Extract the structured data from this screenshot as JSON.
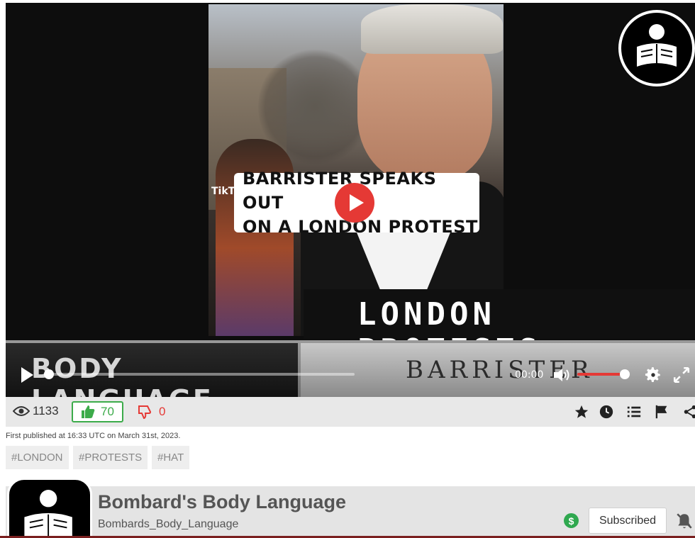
{
  "video": {
    "caption_line1": "BARRISTER SPEAKS OUT",
    "caption_line2": "ON A LONDON PROTEST",
    "tiktok_label": "TikTok",
    "banner_text": "LONDON PROTESTS",
    "lower_left_text": "BODY LANGUAGE",
    "lower_right_text": "BARRISTER",
    "time": "00:00",
    "progress": 0.0,
    "volume": 0.85
  },
  "stats": {
    "views": "1133",
    "likes": "70",
    "dislikes": "0"
  },
  "actions": [
    "star-icon",
    "clock-icon",
    "list-icon",
    "flag-icon",
    "share-icon"
  ],
  "published": "First published at 16:33 UTC on March 31st, 2023.",
  "tags": [
    "#LONDON",
    "#PROTESTS",
    "#HAT"
  ],
  "channel": {
    "name": "Bombard's Body Language",
    "handle": "Bombards_Body_Language",
    "subscribe_label": "Subscribed",
    "money_symbol": "$"
  },
  "colors": {
    "accent_red": "#e53935",
    "like_green": "#3cab4a"
  }
}
